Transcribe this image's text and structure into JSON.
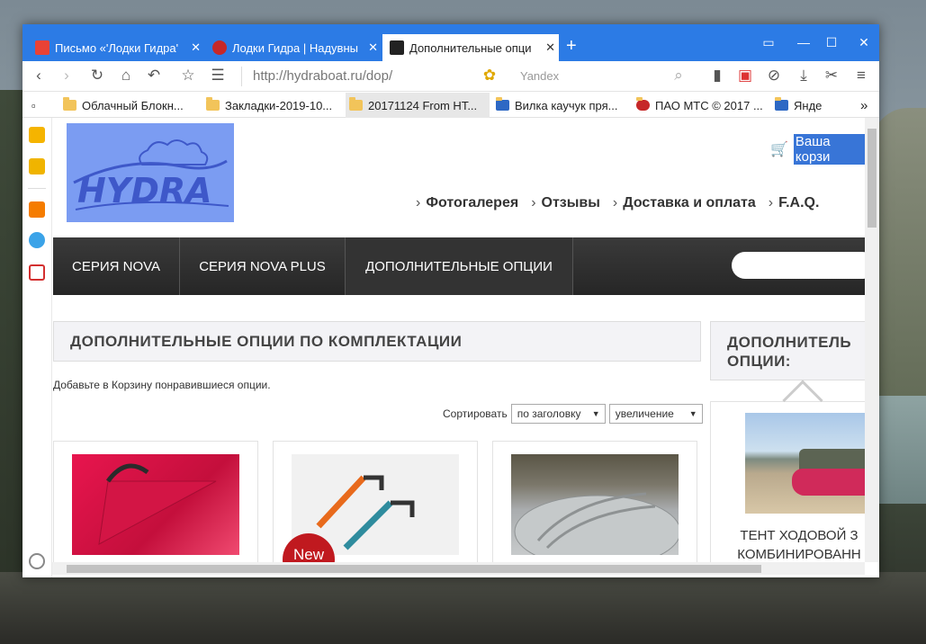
{
  "browser": {
    "tabs": [
      {
        "title": "Письмо «'Лодки Гидра'",
        "active": false
      },
      {
        "title": "Лодки Гидра | Надувны",
        "active": false
      },
      {
        "title": "Дополнительные опци",
        "active": true
      }
    ],
    "new_tab_label": "+",
    "url": "http://hydraboat.ru/dop/",
    "search_placeholder": "Yandex",
    "bookmarks": [
      "Облачный Блокн...",
      "Закладки-2019-10...",
      "20171124 From HT...",
      "Вилка каучук пря...",
      "ПАО МТС © 2017 ...",
      "Янде"
    ],
    "bookmarks_more": "»",
    "accent_color": "#2c7be5"
  },
  "page": {
    "cart_label": "Ваша корзи",
    "top_nav": [
      "Фотогалерея",
      "Отзывы",
      "Доставка и оплата",
      "F.A.Q."
    ],
    "main_nav": [
      "СЕРИЯ NOVA",
      "СЕРИЯ NOVA PLUS",
      "ДОПОЛНИТЕЛЬНЫЕ ОПЦИИ"
    ],
    "section_title": "ДОПОЛНИТЕЛЬНЫЕ ОПЦИИ ПО КОМПЛЕКТАЦИИ",
    "intro_text": "Добавьте в Корзину понравившиеся опции.",
    "sort_label": "Сортировать",
    "sort_field": "по заголовку",
    "sort_order": "увеличение",
    "new_badge": "New",
    "side_title": "ДОПОЛНИТЕЛЬ ОПЦИИ:",
    "side_product_title": "ТЕНТ ХОДОВОЙ З КОМБИНИРОВАНН"
  }
}
